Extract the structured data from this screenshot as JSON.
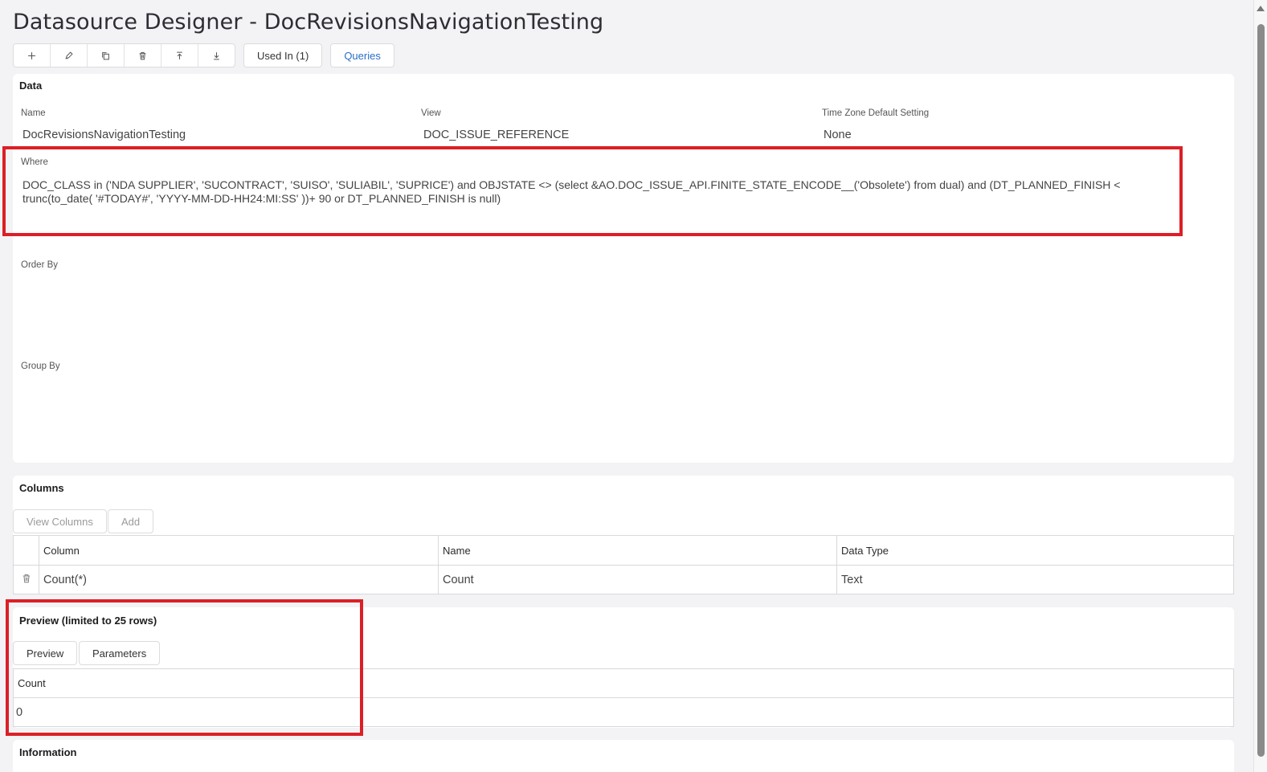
{
  "page": {
    "title": "Datasource Designer - DocRevisionsNavigationTesting"
  },
  "toolbar": {
    "icons": [
      "plus-icon",
      "edit-icon",
      "copy-icon",
      "delete-icon",
      "move-up-icon",
      "move-down-icon"
    ],
    "used_in_label": "Used In (1)",
    "queries_label": "Queries"
  },
  "data_panel": {
    "title": "Data",
    "name_label": "Name",
    "name_value": "DocRevisionsNavigationTesting",
    "view_label": "View",
    "view_value": "DOC_ISSUE_REFERENCE",
    "timezone_label": "Time Zone Default Setting",
    "timezone_value": "None",
    "where_label": "Where",
    "where_value": "DOC_CLASS in ('NDA SUPPLIER', 'SUCONTRACT', 'SUISO', 'SULIABIL', 'SUPRICE') and OBJSTATE <> (select &AO.DOC_ISSUE_API.FINITE_STATE_ENCODE__('Obsolete') from dual) and (DT_PLANNED_FINISH < trunc(to_date( '#TODAY#', 'YYYY-MM-DD-HH24:MI:SS' ))+ 90 or DT_PLANNED_FINISH is null)",
    "order_by_label": "Order By",
    "group_by_label": "Group By"
  },
  "columns_panel": {
    "title": "Columns",
    "view_columns_label": "View Columns",
    "add_label": "Add",
    "headers": [
      "Column",
      "Name",
      "Data Type"
    ],
    "rows": [
      {
        "column": "Count(*)",
        "name": "Count",
        "data_type": "Text"
      }
    ]
  },
  "preview_panel": {
    "title": "Preview (limited to 25 rows)",
    "preview_label": "Preview",
    "parameters_label": "Parameters",
    "header": "Count",
    "value": "0"
  },
  "information_panel": {
    "title": "Information"
  },
  "colors": {
    "highlight": "#dc1f26",
    "link": "#2a6ec7",
    "background": "#f3f3f5"
  }
}
